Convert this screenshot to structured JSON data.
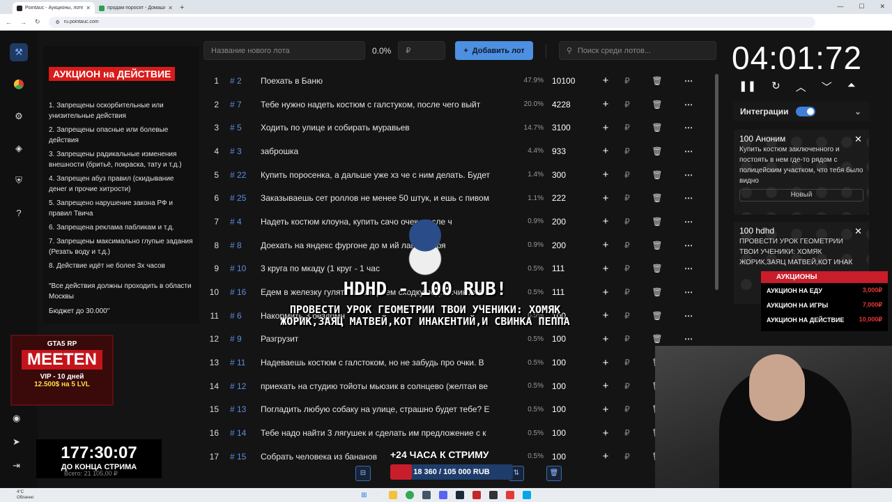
{
  "browser": {
    "tabs": [
      {
        "title": "Pointauc - Аукционы, лотереи"
      },
      {
        "title": "продам поросят - Домашние"
      }
    ],
    "url": "ru.pointauc.com"
  },
  "rules": {
    "title": "АУКЦИОН на ДЕЙСТВИЕ",
    "items": [
      "1. Запрещены оскорбительные или унизительные действия",
      "2. Запрещены опасные или болевые действия",
      "3. Запрещены радикальные изменения внешности (бритьё, покраска, тату и т.д.)",
      "4. Запрещен абуз правил (скидывание денег и прочие хитрости)",
      "5. Запрещено нарушение закона РФ и правил Твича",
      "6. Запрещена реклама пабликам и т.д.",
      "7. Запрещены максимально глупые задания (Резать воду и т.д.)",
      "8. Действие идёт не более 3х часов"
    ],
    "note": "\"Все действия должны проходить в области Москвы",
    "budget": "Бюджет до 30.000\""
  },
  "promo": {
    "game": "GTA5 RP",
    "name": "MEETEN",
    "vip": "VIP - 10 дней",
    "vip_price": "12.500$ на 5 LVL"
  },
  "stream_timer": {
    "time": "177:30:07",
    "label": "ДО КОНЦА СТРИМА",
    "total": "Всего: 21 105,00 ₽"
  },
  "toolbar": {
    "lot_placeholder": "Название нового лота",
    "percent": "0.0%",
    "amount_placeholder": "₽",
    "add_button": "Добавить лот",
    "search_placeholder": "Поиск среди лотов..."
  },
  "lots": [
    {
      "n": "1",
      "id": "# 2",
      "title": "Поехать в Баню",
      "pct": "47.9%",
      "amount": "10100"
    },
    {
      "n": "2",
      "id": "# 7",
      "title": "Тебе нужно надеть костюм с галстуком, после чего выйт",
      "pct": "20.0%",
      "amount": "4228"
    },
    {
      "n": "3",
      "id": "# 5",
      "title": "Ходить по улице и собирать муравьев",
      "pct": "14.7%",
      "amount": "3100"
    },
    {
      "n": "4",
      "id": "# 3",
      "title": "заброшка",
      "pct": "4.4%",
      "amount": "933"
    },
    {
      "n": "5",
      "id": "# 22",
      "title": "Купить поросенка, а дальше уже хз че с ним делать. Будет",
      "pct": "1.4%",
      "amount": "300"
    },
    {
      "n": "6",
      "id": "# 25",
      "title": "Заказываешь сет роллов не менее 50 штук, и ешь с пивом",
      "pct": "1.1%",
      "amount": "222"
    },
    {
      "n": "7",
      "id": "# 4",
      "title": "Надеть костюм клоуна, купить сачо   очек, после ч",
      "pct": "0.9%",
      "amount": "200"
    },
    {
      "n": "8",
      "id": "# 8",
      "title": "Доехать на яндекс фургоне до м   ий лагерь, пря",
      "pct": "0.9%",
      "amount": "200"
    },
    {
      "n": "9",
      "id": "# 10",
      "title": "3 круга по мкаду (1 круг - 1 час",
      "pct": "0.5%",
      "amount": "111"
    },
    {
      "n": "10",
      "id": "# 16",
      "title": "Едем в железку гулять и собираем сходку подписчиков те",
      "pct": "0.5%",
      "amount": "111"
    },
    {
      "n": "11",
      "id": "# 6",
      "title": "Накормить 3 бездомн",
      "pct": "0.5%",
      "amount": "100"
    },
    {
      "n": "12",
      "id": "# 9",
      "title": "Разгрузит",
      "pct": "0.5%",
      "amount": "100"
    },
    {
      "n": "13",
      "id": "# 11",
      "title": "Надеваешь костюм с галстоком, но не забудь про очки. В",
      "pct": "0.5%",
      "amount": "100"
    },
    {
      "n": "14",
      "id": "# 12",
      "title": "приехать на студию тойоты мьюзик в солнцево (желтая ве",
      "pct": "0.5%",
      "amount": "100"
    },
    {
      "n": "15",
      "id": "# 13",
      "title": "Погладить любую собаку на улице, страшно будет тебе? Е",
      "pct": "0.5%",
      "amount": "100"
    },
    {
      "n": "16",
      "id": "# 14",
      "title": "Тебе надо найти 3 лягушек и сделать им предложение с к",
      "pct": "0.5%",
      "amount": "100"
    },
    {
      "n": "17",
      "id": "# 15",
      "title": "Собрать человека из бананов",
      "pct": "0.5%",
      "amount": "100"
    }
  ],
  "timer": {
    "value": "04:01:72"
  },
  "integrations": {
    "label": "Интеграции"
  },
  "cards": [
    {
      "header": "100 Аноним",
      "text": "Купить костюм заключенного и постоять в нем где-то рядом с полицейским участком, что тебя было видно",
      "select": "Новый"
    },
    {
      "header": "100 hdhd",
      "text": "ПРОВЕСТИ УРОК ГЕОМЕТРИИ ТВОИ УЧЕНИКИ: ХОМЯК ЖОРИК,ЗАЯЦ МАТВЕЙ,КОТ ИНАК"
    }
  ],
  "auctions": {
    "title": "АУКЦИОНЫ",
    "rows": [
      {
        "label": "АУКЦИОН НА ЕДУ",
        "price": "3,000₽"
      },
      {
        "label": "АУКЦИОН НА ИГРЫ",
        "price": "7,000₽"
      },
      {
        "label": "АУКЦИОН НА ДЕЙСТВИЕ",
        "price": "10,000₽"
      }
    ]
  },
  "alert": {
    "title": "HDHD - 100 RUB!",
    "message": "ПРОВЕСТИ УРОК ГЕОМЕТРИИ ТВОИ УЧЕНИКИ: ХОМЯК ЖОРИК,ЗАЯЦ МАТВЕЙ,КОТ ИНАКЕНТИЙ,И СВИНКА ПЕППА"
  },
  "goal": {
    "plus": "+24 ЧАСА К СТРИМУ",
    "progress_text": "18 360 / 105 000 RUB",
    "progress_fraction": 0.175
  },
  "weather": {
    "temp": "4°C",
    "cond": "Облачно"
  }
}
